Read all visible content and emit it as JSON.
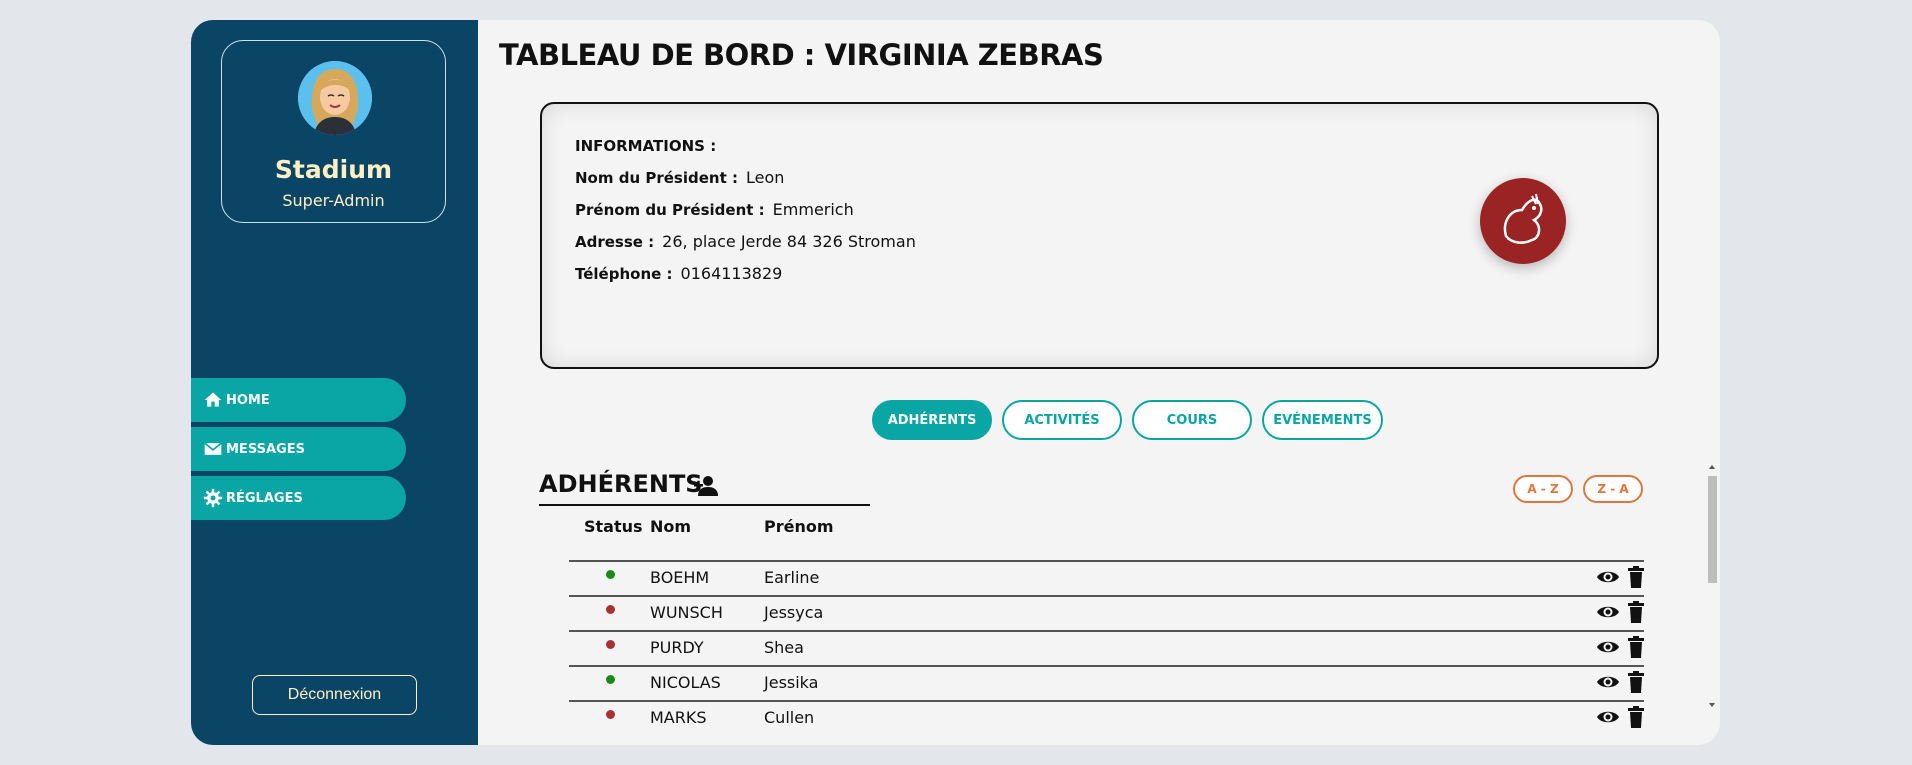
{
  "sidebar": {
    "profile": {
      "name": "Stadium",
      "role": "Super-Admin"
    },
    "nav": [
      {
        "label": "HOME",
        "icon": "home-icon"
      },
      {
        "label": "MESSAGES",
        "icon": "mail-icon"
      },
      {
        "label": "RÉGLAGES",
        "icon": "gear-icon"
      }
    ],
    "logout_label": "Déconnexion"
  },
  "main": {
    "title": "TABLEAU DE BORD : VIRGINIA ZEBRAS",
    "info": {
      "heading": "INFORMATIONS :",
      "rows": [
        {
          "label": "Nom du Président :",
          "value": "Leon"
        },
        {
          "label": "Prénom du Président :",
          "value": "Emmerich"
        },
        {
          "label": "Adresse :",
          "value": "26, place Jerde 84 326 Stroman"
        },
        {
          "label": "Téléphone :",
          "value": "0164113829"
        }
      ]
    },
    "tabs": [
      {
        "label": "ADHÉRENTS",
        "active": true
      },
      {
        "label": "ACTIVITÉS",
        "active": false
      },
      {
        "label": "COURS",
        "active": false
      },
      {
        "label": "EVÉNEMENTS",
        "active": false
      }
    ],
    "section": {
      "title": "ADHÉRENTS",
      "sort_asc": "A - Z",
      "sort_desc": "Z - A",
      "columns": [
        "Status",
        "Nom",
        "Prénom"
      ],
      "members": [
        {
          "status": "active",
          "nom": "BOEHM",
          "prenom": "Earline"
        },
        {
          "status": "inactive",
          "nom": "WUNSCH",
          "prenom": "Jessyca"
        },
        {
          "status": "inactive",
          "nom": "PURDY",
          "prenom": "Shea"
        },
        {
          "status": "active",
          "nom": "NICOLAS",
          "prenom": "Jessika"
        },
        {
          "status": "inactive",
          "nom": "MARKS",
          "prenom": "Cullen"
        }
      ]
    }
  },
  "colors": {
    "sidebar_bg": "#0b4566",
    "accent_teal": "#0aa5a5",
    "sort_orange": "#e0763e",
    "status_active": "#1a8a1a",
    "status_inactive": "#a83232",
    "logo_red": "#9a2424"
  }
}
